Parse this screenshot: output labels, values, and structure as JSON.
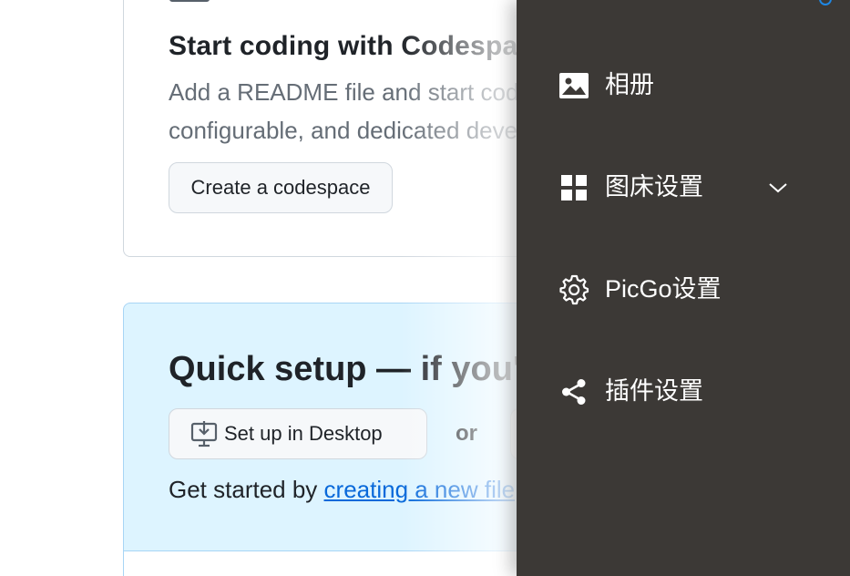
{
  "background": {
    "codespaces_card": {
      "title": "Start coding with Codespaces",
      "description": "Add a README file and start coding in a secure, configurable, and dedicated development environment.",
      "button_label": "Create a codespace"
    },
    "quick_setup": {
      "title": "Quick setup — if you've done this kind of thing before",
      "desktop_button_label": "Set up in Desktop",
      "or_label": "or",
      "get_started_prefix": "Get started by ",
      "get_started_link": "creating a new file"
    }
  },
  "drawer": {
    "items": [
      {
        "label": "相册",
        "icon": "image-icon"
      },
      {
        "label": "图床设置",
        "icon": "grid-icon",
        "expandable": true
      },
      {
        "label": "PicGo设置",
        "icon": "gear-icon"
      },
      {
        "label": "插件设置",
        "icon": "share-icon"
      }
    ]
  },
  "colors": {
    "drawer_bg": "#3c3936",
    "quick_setup_bg": "#ddf4ff",
    "link": "#0969da",
    "text": "#1f2328",
    "muted": "#656d76"
  }
}
